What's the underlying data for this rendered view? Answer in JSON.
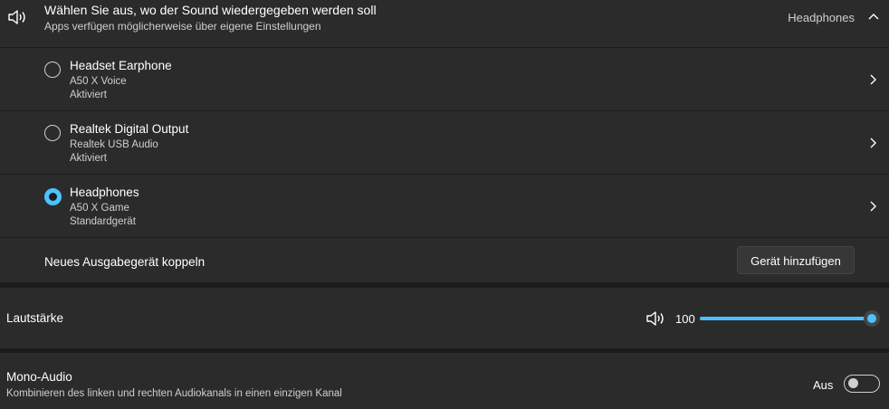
{
  "output": {
    "title": "Wählen Sie aus, wo der Sound wiedergegeben werden soll",
    "subtitle": "Apps verfügen möglicherweise über eigene Einstellungen",
    "current_device": "Headphones",
    "icons": {
      "header": "speaker-icon",
      "collapse": "chevron-up-icon"
    },
    "devices": [
      {
        "name": "Headset Earphone",
        "driver": "A50 X Voice",
        "status": "Aktiviert",
        "selected": false
      },
      {
        "name": "Realtek Digital Output",
        "driver": "Realtek USB Audio",
        "status": "Aktiviert",
        "selected": false
      },
      {
        "name": "Headphones",
        "driver": "A50 X Game",
        "status": "Standardgerät",
        "selected": true
      }
    ]
  },
  "pair": {
    "label": "Neues Ausgabegerät koppeln",
    "button_label": "Gerät hinzufügen"
  },
  "volume": {
    "label": "Lautstärke",
    "value": "100",
    "level": 1.0,
    "icon": "speaker-icon"
  },
  "mono": {
    "label": "Mono-Audio",
    "description": "Kombinieren des linken und rechten Audiokanals in einen einzigen Kanal",
    "state": "Aus",
    "enabled": false
  },
  "colors": {
    "accent": "#4cc2ff",
    "card": "#2b2b2b",
    "background": "#1c1c1c"
  }
}
